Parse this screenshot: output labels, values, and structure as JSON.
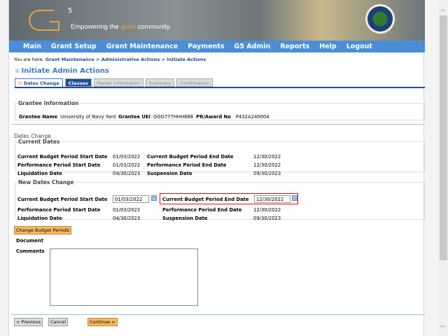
{
  "banner": {
    "logo": "G5",
    "tagline_pre": "Empowering the ",
    "tagline_accent": "grant",
    "tagline_post": " community.",
    "accent": "#f0a030"
  },
  "nav": [
    "Main",
    "Grant Setup",
    "Grant Maintenance",
    "Payments",
    "G5 Admin",
    "Reports",
    "Help",
    "Logout"
  ],
  "breadcrumb": {
    "prefix": "You are here:",
    "items": [
      "Grant Maintenance",
      "Administrative Actions",
      "Initiate Actions"
    ],
    "sep": " > "
  },
  "page_title": "Initiate Admin Actions",
  "tabs": [
    "Dates Change",
    "Clauses",
    "Packet Information",
    "Summary",
    "Confirmation"
  ],
  "grantee": {
    "legend": "Grantee Information",
    "name_label": "Grantee Name",
    "name": "University of Navy Yard",
    "uei_label": "Grantee UEI",
    "uei": "GGG777HHH888",
    "award_label": "PR/Award No",
    "award": "P432A240004"
  },
  "section_title": "Dates Change",
  "current": {
    "legend": "Current Dates",
    "rows": [
      {
        "l1": "Current Budget Period Start Date",
        "v1": "01/03/2022",
        "l2": "Current Budget Period End Date",
        "v2": "12/30/2022"
      },
      {
        "l1": "Performance Period Start Date",
        "v1": "01/03/2022",
        "l2": "Performance Period End Date",
        "v2": "12/30/2022"
      },
      {
        "l1": "Liquidation Date",
        "v1": "04/30/2023",
        "l2": "Suspension Date",
        "v2": "09/30/2023"
      }
    ]
  },
  "new": {
    "legend": "New Dates Change",
    "rows": [
      {
        "l1": "Current Budget Period Start Date",
        "v1": "01/03/2022",
        "l2": "Current Budget Period End Date",
        "v2": "12/30/2022"
      },
      {
        "l1": "Performance Period Start Date",
        "v1": "01/03/2022",
        "l2": "Performance Period End Date",
        "v2": "12/30/2022"
      },
      {
        "l1": "Liquidation Date",
        "v1": "04/30/2023",
        "l2": "Suspension Date",
        "v2": "09/30/2023"
      }
    ]
  },
  "change_button": "Change Budget Periods",
  "document_label": "Document",
  "comments_label": "Comments",
  "comments_value": "",
  "buttons": {
    "previous": "< Previous",
    "cancel": "Cancel",
    "continue": "Continue >"
  }
}
